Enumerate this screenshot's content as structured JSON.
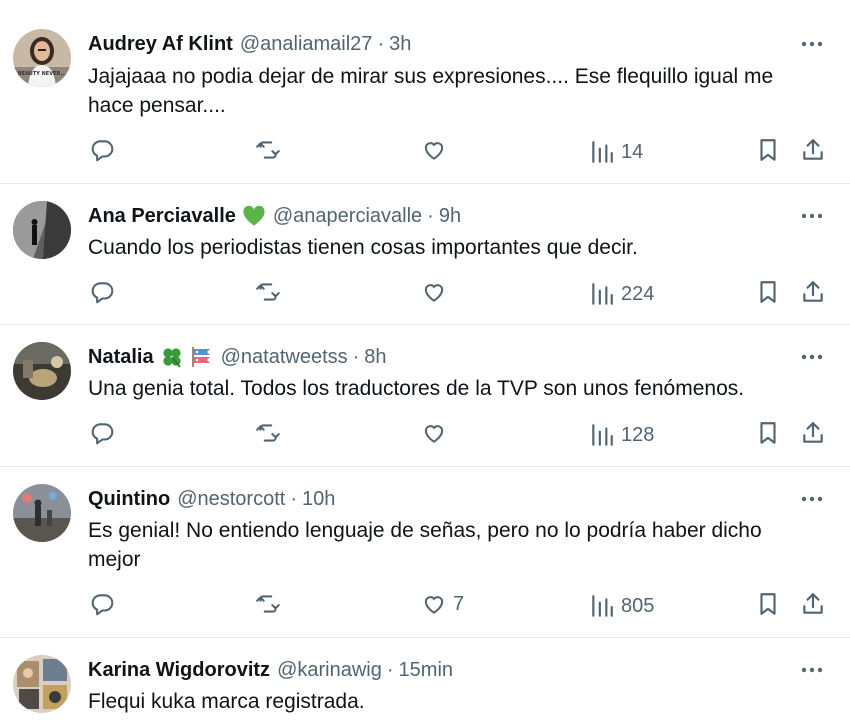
{
  "tweets": [
    {
      "name": "Audrey Af Klint",
      "handle": "@analiamail27",
      "time": "3h",
      "text": "Jajajaaa no podia dejar de mirar sus expresiones.... Ese flequillo igual me hace pensar....",
      "views": "14",
      "likes": "",
      "badges": [],
      "avatar_text": "BEAUTY NEVER..."
    },
    {
      "name": "Ana Perciavalle",
      "handle": "@anaperciavalle",
      "time": "9h",
      "text": "Cuando los periodistas tienen cosas importantes que decir.",
      "views": "224",
      "likes": "",
      "badges": [
        "green-heart-icon"
      ]
    },
    {
      "name": "Natalia",
      "handle": "@natatweetss",
      "time": "8h",
      "text": "Una genia total. Todos los traductores de la TVP son unos fenómenos.",
      "views": "128",
      "likes": "",
      "badges": [
        "four-leaf-clover-icon",
        "carp-streamer-icon"
      ]
    },
    {
      "name": "Quintino",
      "handle": "@nestorcott",
      "time": "10h",
      "text": "Es genial! No entiendo lenguaje de señas, pero no lo podría haber dicho mejor",
      "views": "805",
      "likes": "7",
      "badges": []
    },
    {
      "name": "Karina Wigdorovitz",
      "handle": "@karinawig",
      "time": "15min",
      "text": "Flequi kuka marca registrada.",
      "badges": []
    }
  ],
  "separator": "·",
  "colors": {
    "text": "#0f1419",
    "secondary": "#536471",
    "divider": "#e6e9eb",
    "green_heart": "#5bb34a",
    "clover": "#3a9a3a"
  }
}
